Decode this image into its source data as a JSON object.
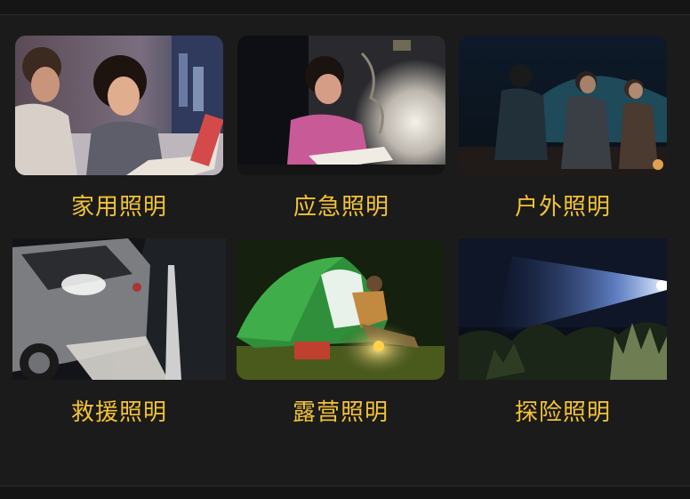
{
  "colors": {
    "background": "#1b1b1b",
    "caption": "#f3c335"
  },
  "tiles": [
    {
      "label": "家用照明",
      "scene": "family-reading-scene"
    },
    {
      "label": "应急照明",
      "scene": "child-studying-scene"
    },
    {
      "label": "户外照明",
      "scene": "campfire-group-scene"
    },
    {
      "label": "救援照明",
      "scene": "car-roadside-scene"
    },
    {
      "label": "露营照明",
      "scene": "tent-camping-scene"
    },
    {
      "label": "探险照明",
      "scene": "flashlight-beam-scene"
    }
  ]
}
